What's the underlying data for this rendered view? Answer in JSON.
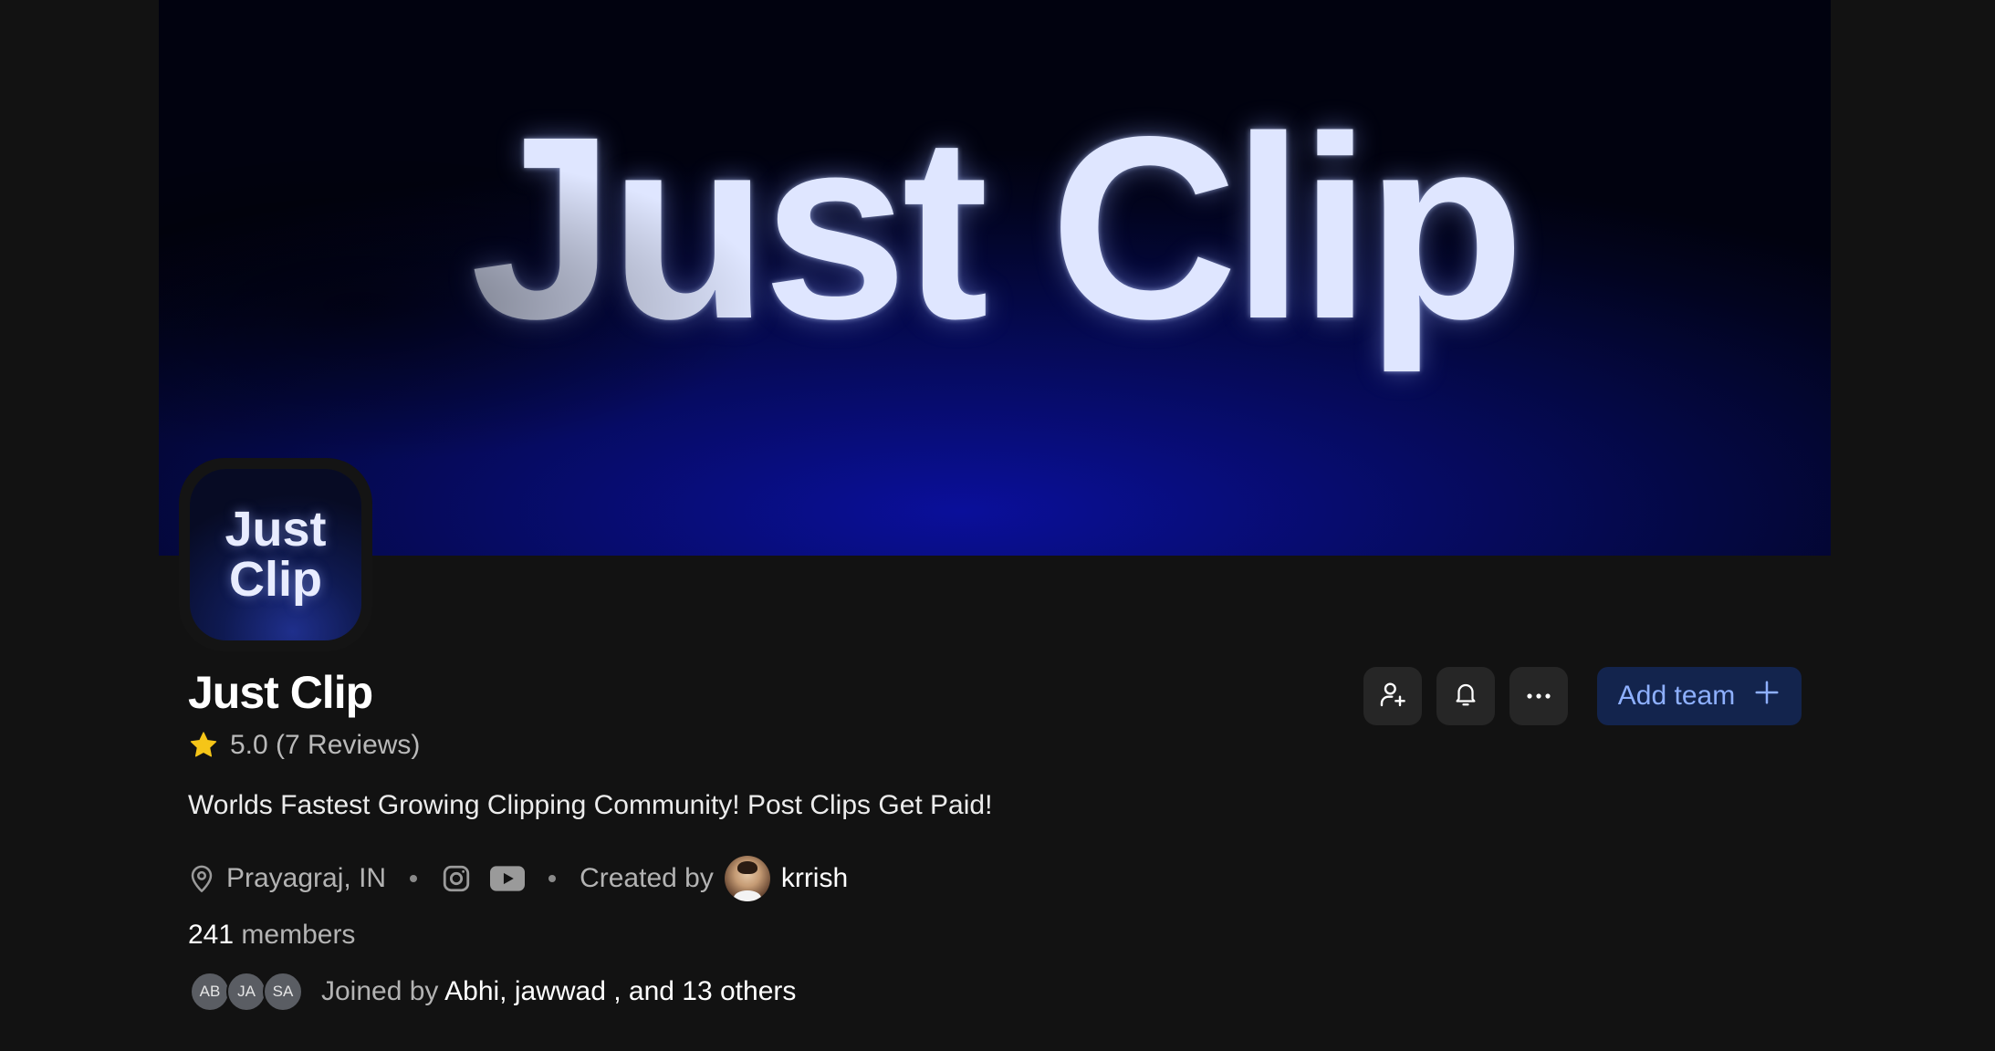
{
  "banner": {
    "title": "Just Clip"
  },
  "avatar": {
    "line1": "Just",
    "line2": "Clip"
  },
  "group": {
    "name": "Just Clip",
    "rating": "5.0 (7 Reviews)",
    "description": "Worlds Fastest Growing Clipping Community! Post Clips Get Paid!"
  },
  "meta": {
    "location": "Prayagraj, IN",
    "created_by_label": "Created by",
    "creator_name": "krrish",
    "socials": [
      "instagram-icon",
      "youtube-icon"
    ]
  },
  "members": {
    "count": "241",
    "label": "members"
  },
  "joined": {
    "avatars": [
      "AB",
      "JA",
      "SA"
    ],
    "prefix": "Joined by",
    "names": "Abhi, jawwad , and 13 others"
  },
  "actions": {
    "add_team_label": "Add team",
    "icons": [
      "add-user-icon",
      "bell-icon",
      "more-icon",
      "plus-icon"
    ]
  },
  "colors": {
    "background": "#121212",
    "accent_button_bg": "#13244d",
    "accent_button_text": "#8eb0ff",
    "star": "#f5c518"
  }
}
